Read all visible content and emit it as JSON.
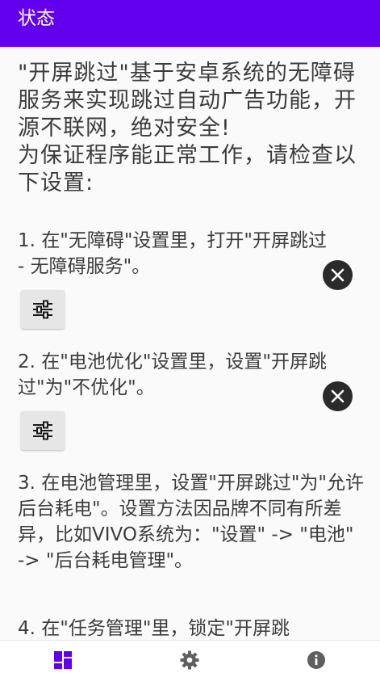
{
  "appbar": {
    "title": "状态",
    "color": "#6200ee"
  },
  "intro": "\"开屏跳过\"基于安卓系统的无障碍服务来实现跳过自动广告功能，开源不联网，绝对安全!\n为保证程序能正常工作，请检查以下设置:",
  "steps": [
    {
      "text": "1. 在\"无障碍\"设置里，打开\"开屏跳过 - 无障碍服务\"。",
      "status_icon": "close-icon",
      "action_icon": "settings-sliders-icon"
    },
    {
      "text": "2. 在\"电池优化\"设置里，设置\"开屏跳过\"为\"不优化\"。",
      "status_icon": "close-icon",
      "action_icon": "settings-sliders-icon"
    },
    {
      "text": "3. 在电池管理里，设置\"开屏跳过\"为\"允许后台耗电\"。设置方法因品牌不同有所差异，比如VIVO系统为：\"设置\" -> \"电池\" -> \"后台耗电管理\"。"
    },
    {
      "text": "4. 在\"任务管理\"里，锁定\"开屏跳"
    }
  ],
  "bottom_nav": [
    {
      "icon": "dashboard-icon",
      "active": true
    },
    {
      "icon": "gear-icon",
      "active": false
    },
    {
      "icon": "info-icon",
      "active": false
    }
  ],
  "colors": {
    "accent": "#6200ee",
    "icon_dark": "#2b2b2b",
    "inactive_icon": "#5f5f5f"
  }
}
